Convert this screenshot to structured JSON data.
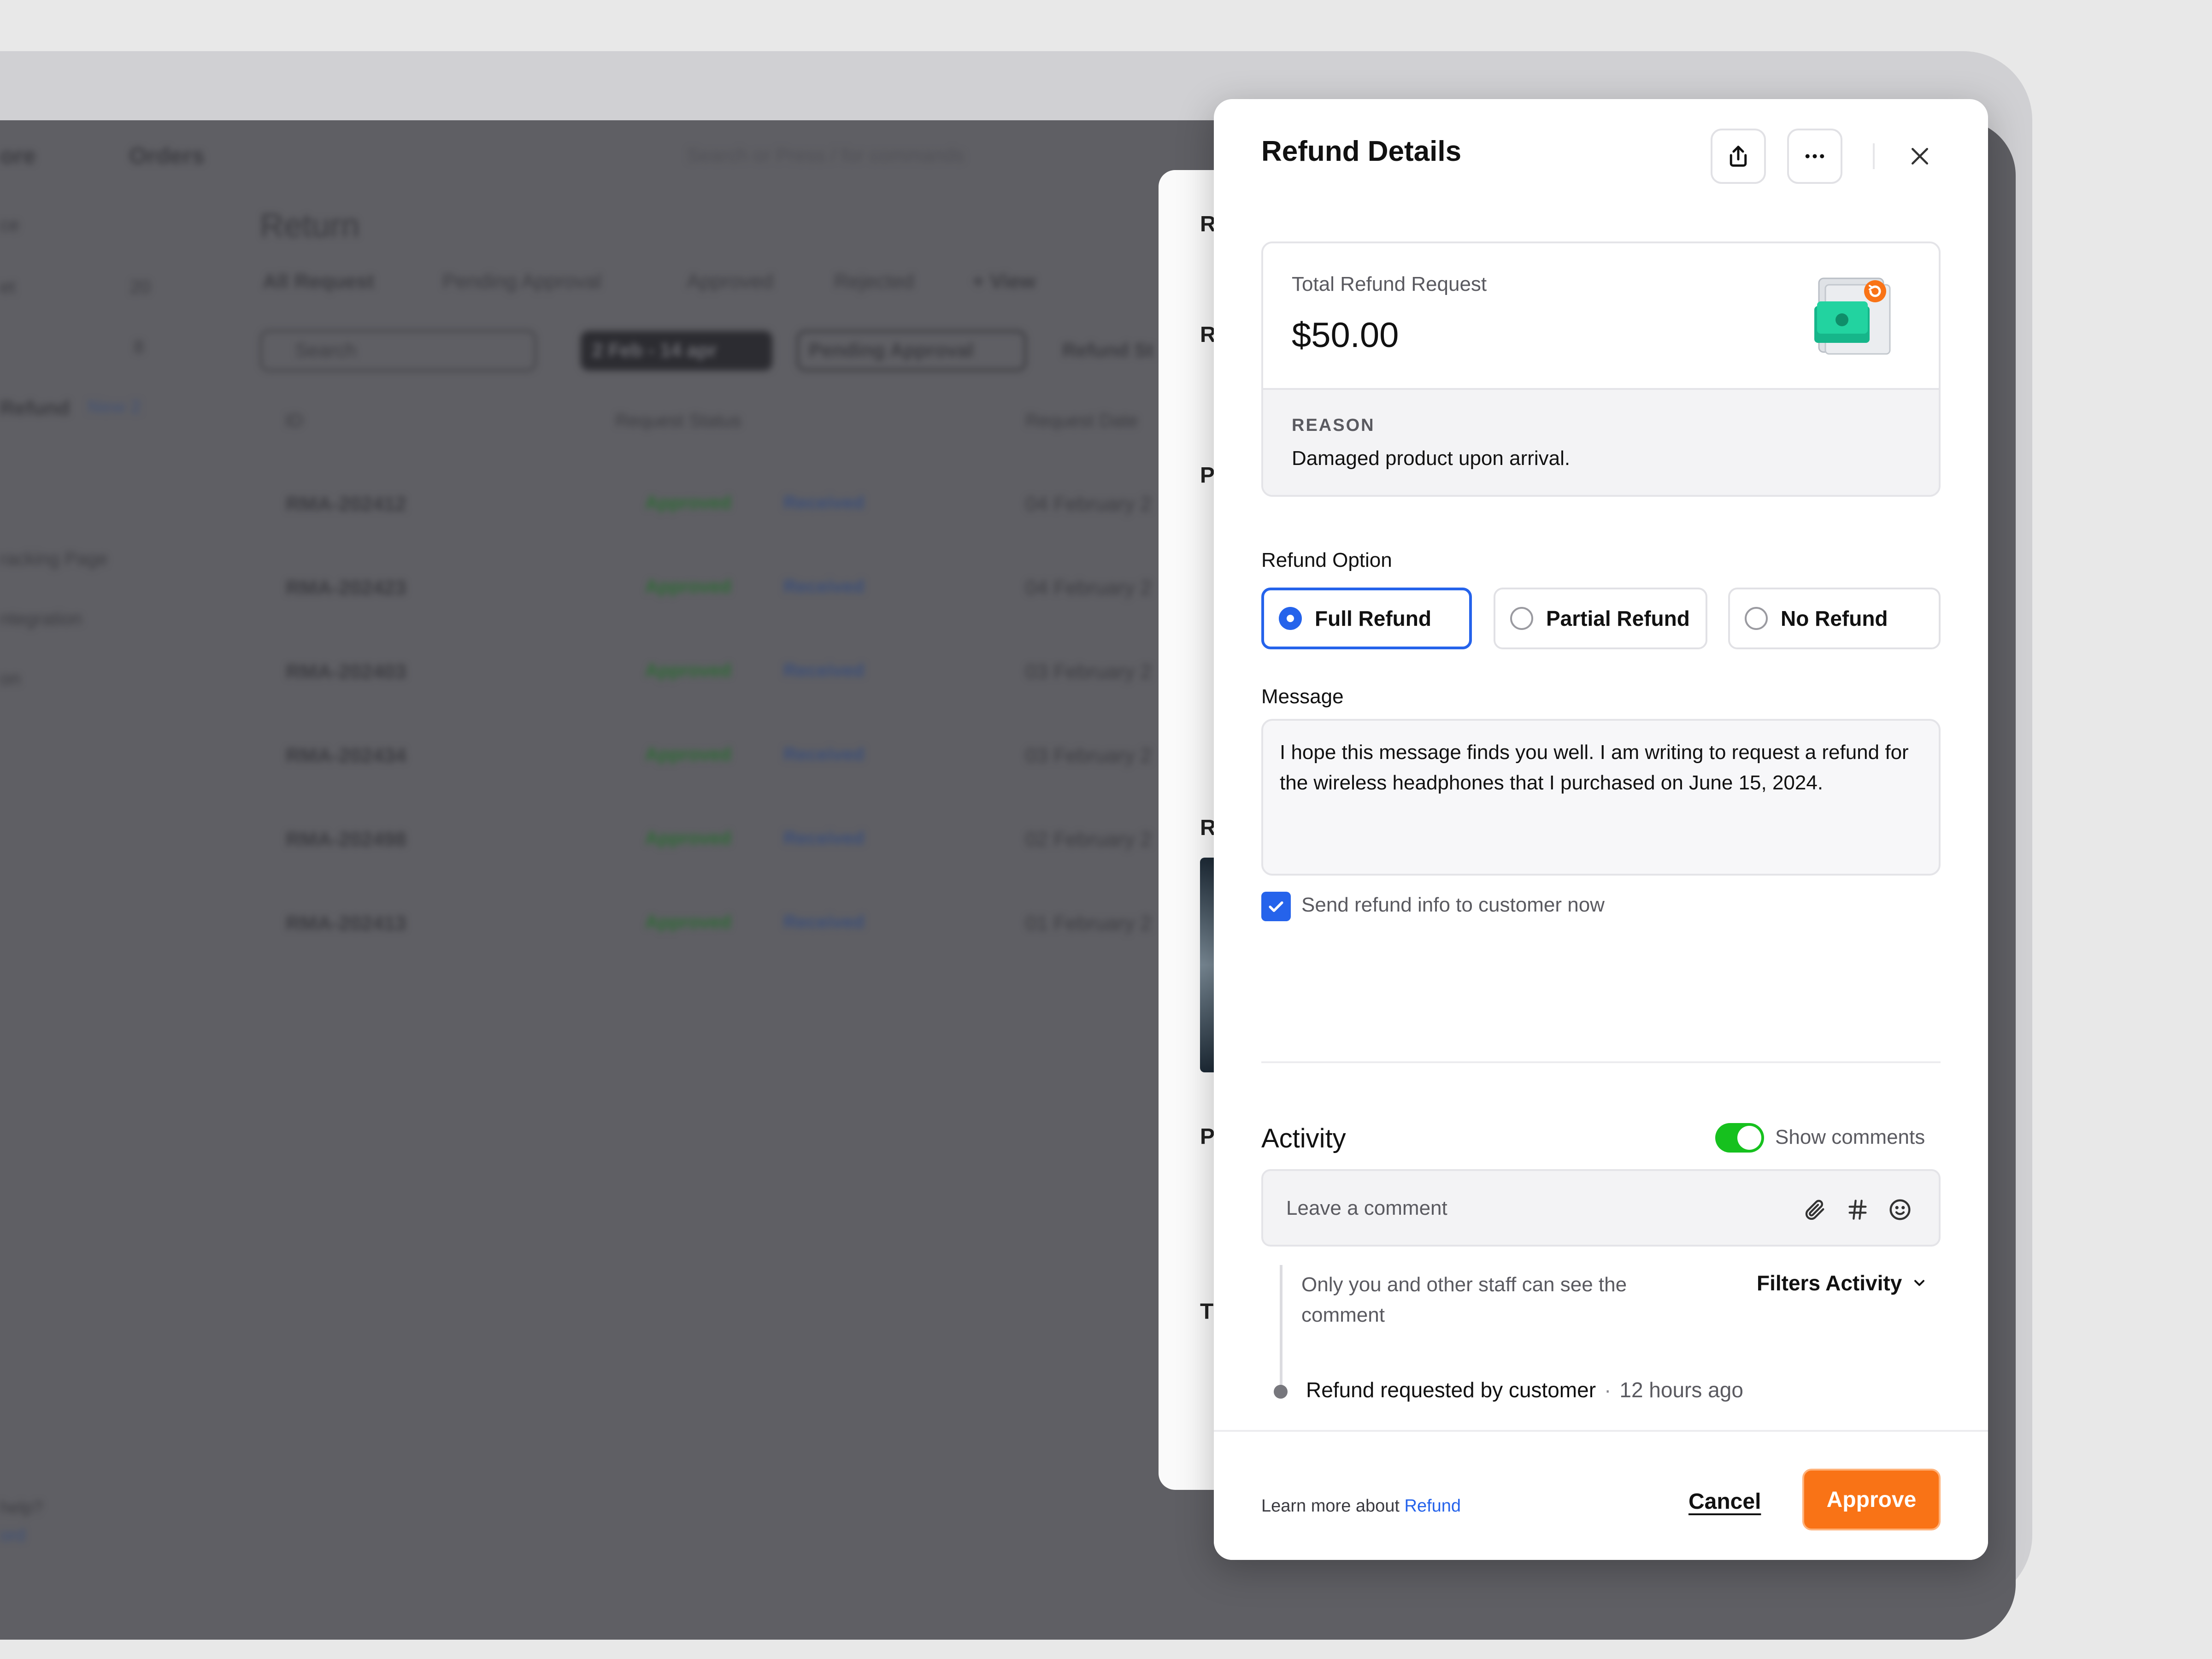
{
  "background": {
    "store_label": "ore",
    "breadcrumb": "Orders",
    "search_placeholder": "Search or Press / for commands",
    "page_title": "Return",
    "tabs": [
      "All Request",
      "Pending Approval",
      "Approved",
      "Rejected"
    ],
    "add_view": "+ View",
    "filter_search": "Search",
    "date_filter": "2 Feb - 14 apr",
    "status_filter": "Pending Approval",
    "refund_filter": "Refund St",
    "columns": [
      "ID",
      "Request Status",
      "Request Date"
    ],
    "rows": [
      {
        "id": "RMA-202412",
        "status": "Approved",
        "tag": "Received",
        "date": "04 February 2"
      },
      {
        "id": "RMA-202423",
        "status": "Approved",
        "tag": "Received",
        "date": "04 February 2"
      },
      {
        "id": "RMA-202403",
        "status": "Approved",
        "tag": "Received",
        "date": "03 February 2"
      },
      {
        "id": "RMA-202434",
        "status": "Approved",
        "tag": "Received",
        "date": "03 February 2"
      },
      {
        "id": "RMA-202498",
        "status": "Approved",
        "tag": "Received",
        "date": "02 February 2"
      },
      {
        "id": "RMA-202413",
        "status": "Approved",
        "tag": "Received",
        "date": "01 February 2"
      }
    ],
    "sidebar": [
      "ce",
      "et",
      "Refund",
      "racking Page",
      "ntegration",
      "on"
    ],
    "sidebar_counts": [
      "20",
      "8"
    ],
    "sidebar_badge": "New 2",
    "help": "help?",
    "help_link": "ord"
  },
  "modal": {
    "title": "Refund Details",
    "total_label": "Total Refund Request",
    "total_amount": "$50.00",
    "reason_label": "REASON",
    "reason_text": "Damaged product upon arrival.",
    "refund_option_label": "Refund Option",
    "options": [
      {
        "label": "Full Refund",
        "selected": true
      },
      {
        "label": "Partial Refund",
        "selected": false
      },
      {
        "label": "No Refund",
        "selected": false
      }
    ],
    "message_label": "Message",
    "message_text": "I hope this message finds you well. I am writing to request a refund for the wireless headphones that I purchased on June 15, 2024.",
    "send_info_label": "Send refund info to customer now",
    "send_info_checked": true,
    "activity_title": "Activity",
    "show_comments_label": "Show comments",
    "show_comments_on": true,
    "comment_placeholder": "Leave a comment",
    "visibility_note": "Only you and other staff can see the comment",
    "filters_label": "Filters Activity",
    "event_text": "Refund requested by customer",
    "event_sep": "·",
    "event_time": "12 hours ago",
    "learn_prefix": "Learn more about ",
    "learn_link": "Refund",
    "cancel_label": "Cancel",
    "approve_label": "Approve"
  },
  "colors": {
    "accent": "#2563eb",
    "approve": "#f97316",
    "toggle_on": "#16c11e"
  },
  "icons": [
    "share-icon",
    "more-icon",
    "close-icon",
    "refund-money-icon",
    "check-icon",
    "attachment-icon",
    "hashtag-icon",
    "emoji-icon",
    "chevron-down-icon"
  ]
}
